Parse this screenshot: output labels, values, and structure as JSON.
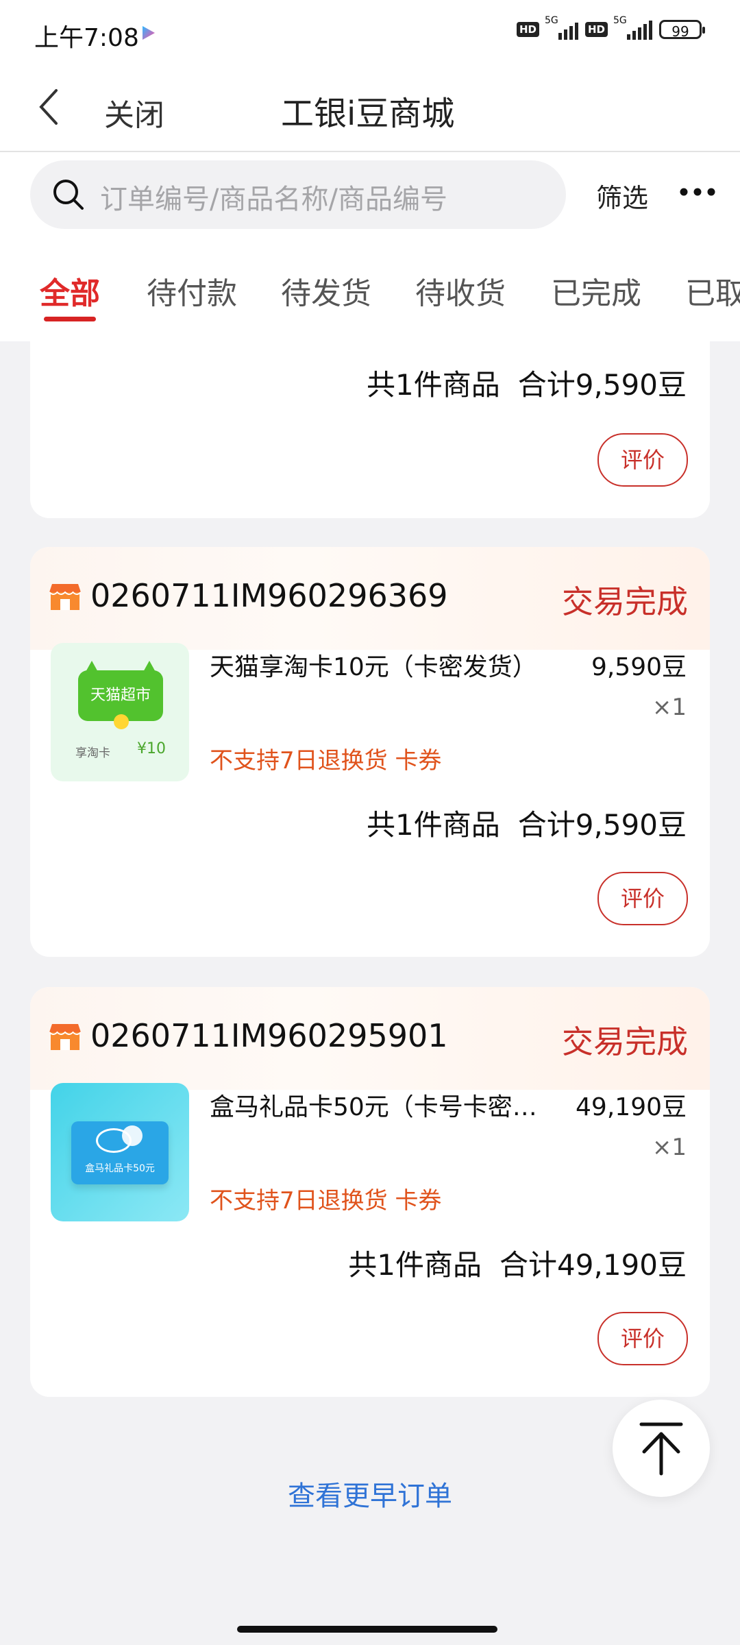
{
  "status_bar": {
    "time": "上午7:08",
    "hd": "HD",
    "net": "5G",
    "battery": "99"
  },
  "nav": {
    "close": "关闭",
    "title": "工银i豆商城"
  },
  "search": {
    "placeholder": "订单编号/商品名称/商品编号",
    "filter": "筛选"
  },
  "tabs": [
    "全部",
    "待付款",
    "待发货",
    "待收货",
    "已完成",
    "已取"
  ],
  "top_card": {
    "count": "共1件商品",
    "total": "合计9,590豆",
    "review": "评价"
  },
  "orders": [
    {
      "order_no": "0260711IM960296369",
      "status": "交易完成",
      "thumb": {
        "brand": "天猫超市",
        "sub": "享淘卡",
        "amount": "¥10"
      },
      "name": "天猫享淘卡10元（卡密发货）",
      "price": "9,590豆",
      "qty": "×1",
      "tags": "不支持7日退换货 卡券",
      "count": "共1件商品",
      "total": "合计9,590豆",
      "review": "评价"
    },
    {
      "order_no": "0260711IM960295901",
      "status": "交易完成",
      "thumb": {
        "brand": "盒马礼品卡50元"
      },
      "name": "盒马礼品卡50元（卡号卡密…",
      "price": "49,190豆",
      "qty": "×1",
      "tags": "不支持7日退换货 卡券",
      "count": "共1件商品",
      "total": "合计49,190豆",
      "review": "评价"
    }
  ],
  "footer": {
    "more": "查看更早订单"
  },
  "colors": {
    "accent_red": "#c8302a",
    "tab_red": "#e02a2a",
    "warn_orange": "#e0531c",
    "link_blue": "#2f73d6"
  }
}
